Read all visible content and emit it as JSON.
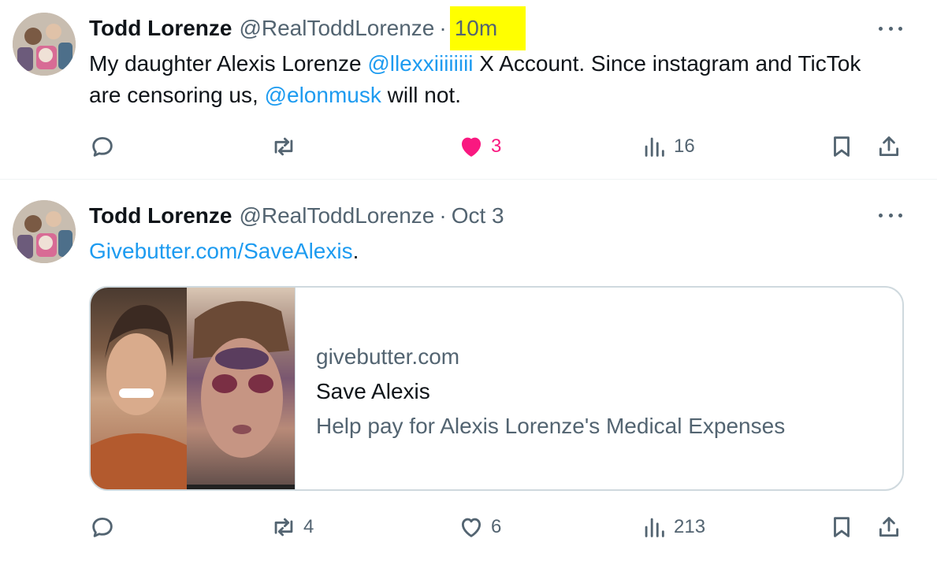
{
  "colors": {
    "text": "#0f1419",
    "secondary": "#536471",
    "link": "#1d9bf0",
    "like_active": "#f91880",
    "highlight": "#ffff00",
    "border": "#cfd9de"
  },
  "tweets": [
    {
      "author_name": "Todd Lorenze",
      "handle": "@RealToddLorenze",
      "separator": "·",
      "time": "10m",
      "time_highlighted": true,
      "text_parts": {
        "p1": "My daughter Alexis Lorenze ",
        "mention1": "@llexxiiiiiiii",
        "p2": " X Account.  Since instagram and TicTok are censoring us, ",
        "mention2": "@elonmusk",
        "p3": " will not."
      },
      "actions": {
        "reply_count": "",
        "repost_count": "",
        "like_count": "3",
        "liked": true,
        "views_count": "16"
      }
    },
    {
      "author_name": "Todd Lorenze",
      "handle": "@RealToddLorenze",
      "separator": "·",
      "time": "Oct 3",
      "text_parts": {
        "link": "Givebutter.com/SaveAlexis",
        "p1": "."
      },
      "card": {
        "domain": "givebutter.com",
        "title": "Save Alexis",
        "description": "Help pay for Alexis Lorenze's Medical Expenses"
      },
      "actions": {
        "reply_count": "",
        "repost_count": "4",
        "like_count": "6",
        "liked": false,
        "views_count": "213"
      }
    }
  ],
  "icons": {
    "reply": "reply-icon",
    "repost": "repost-icon",
    "like": "heart-icon",
    "views": "views-icon",
    "bookmark": "bookmark-icon",
    "share": "share-icon",
    "more": "more-icon"
  }
}
